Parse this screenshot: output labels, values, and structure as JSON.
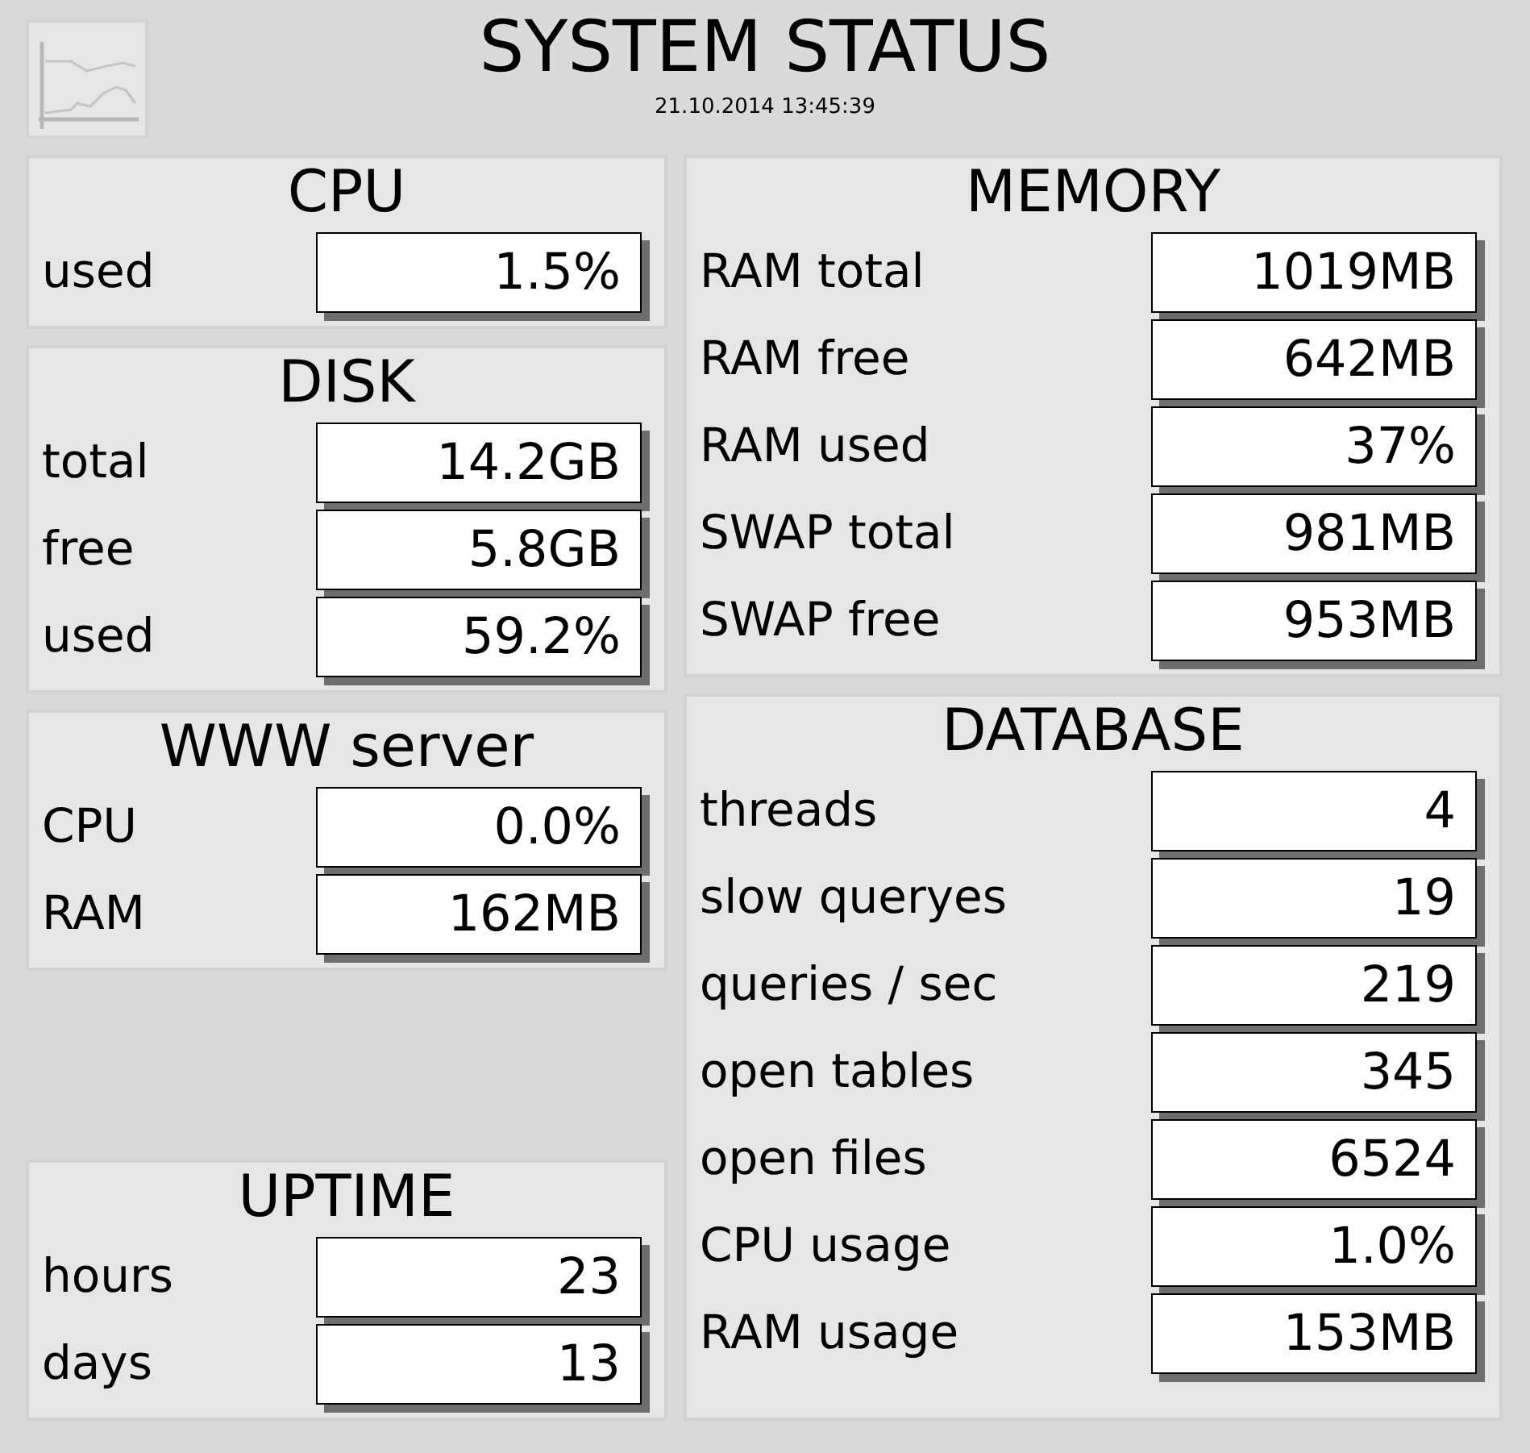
{
  "header": {
    "title": "SYSTEM STATUS",
    "timestamp": "21.10.2014 13:45:39"
  },
  "left_panels": [
    {
      "title": "CPU",
      "rows": [
        {
          "label": "used",
          "value": "1.5%"
        }
      ]
    },
    {
      "title": "DISK",
      "rows": [
        {
          "label": "total",
          "value": "14.2GB"
        },
        {
          "label": "free",
          "value": "5.8GB"
        },
        {
          "label": "used",
          "value": "59.2%"
        }
      ]
    },
    {
      "title": "WWW server",
      "rows": [
        {
          "label": "CPU",
          "value": "0.0%"
        },
        {
          "label": "RAM",
          "value": "162MB"
        }
      ]
    },
    {
      "title": "UPTIME",
      "rows": [
        {
          "label": "hours",
          "value": "23"
        },
        {
          "label": "days",
          "value": "13"
        }
      ]
    }
  ],
  "right_panels": [
    {
      "title": "MEMORY",
      "rows": [
        {
          "label": "RAM total",
          "value": "1019MB"
        },
        {
          "label": "RAM free",
          "value": "642MB"
        },
        {
          "label": "RAM used",
          "value": "37%"
        },
        {
          "label": "SWAP total",
          "value": "981MB"
        },
        {
          "label": "SWAP free",
          "value": "953MB"
        }
      ]
    },
    {
      "title": "DATABASE",
      "rows": [
        {
          "label": "threads",
          "value": "4"
        },
        {
          "label": "slow queryes",
          "value": "19"
        },
        {
          "label": "queries / sec",
          "value": "219"
        },
        {
          "label": "open tables",
          "value": "345"
        },
        {
          "label": "open files",
          "value": "6524"
        },
        {
          "label": "CPU usage",
          "value": "1.0%"
        },
        {
          "label": "RAM usage",
          "value": "153MB"
        }
      ]
    }
  ]
}
